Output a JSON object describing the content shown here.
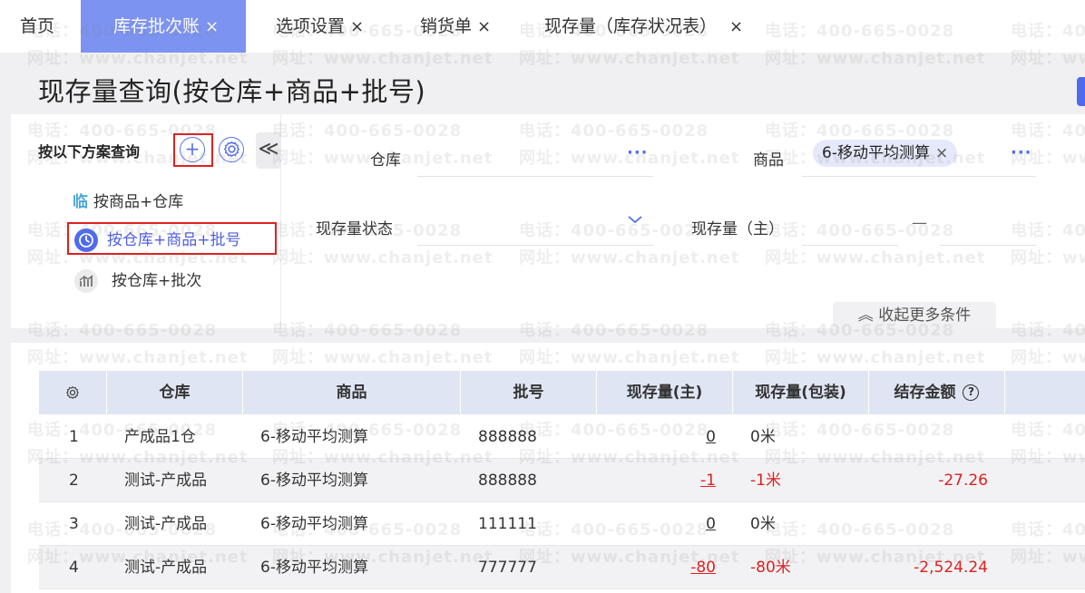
{
  "tabs": [
    {
      "label": "首页",
      "closable": false,
      "active": false
    },
    {
      "label": "库存批次账",
      "closable": true,
      "active": true
    },
    {
      "label": "选项设置",
      "closable": true,
      "active": false
    },
    {
      "label": "销货单",
      "closable": true,
      "active": false
    },
    {
      "label": "现存量（库存状况表）",
      "closable": true,
      "active": false
    }
  ],
  "close_glyph": "×",
  "page_title": "现存量查询(按仓库+商品+批号)",
  "scheme": {
    "title": "按以下方案查询",
    "add_glyph": "+",
    "collapse_glyph": "≪",
    "items": [
      {
        "label": "按商品+仓库",
        "icon": "chart-bar-icon",
        "glyph": "临"
      },
      {
        "label": "按仓库+商品+批号",
        "icon": "clock-icon",
        "active": true
      },
      {
        "label": "按仓库+批次",
        "icon": "chart-line-icon"
      }
    ]
  },
  "filters": {
    "warehouse_label": "仓库",
    "product_label": "商品",
    "product_chip": "6-移动平均测算",
    "status_label": "现存量状态",
    "qty_label": "现存量（主）",
    "qty_separator": "—",
    "dots": "···",
    "more_label": "收起更多条件",
    "more_glyph": "︽"
  },
  "table": {
    "columns": [
      "仓库",
      "商品",
      "批号",
      "现存量(主)",
      "现存量(包装)",
      "结存金额"
    ],
    "help_glyph": "?",
    "rows": [
      {
        "no": "1",
        "warehouse": "产成品1仓",
        "product": "6-移动平均测算",
        "batch": "888888",
        "qty": "0",
        "qty_pack": "0米",
        "amount": "",
        "negative": false
      },
      {
        "no": "2",
        "warehouse": "测试-产成品",
        "product": "6-移动平均测算",
        "batch": "888888",
        "qty": "-1",
        "qty_pack": "-1米",
        "amount": "-27.26",
        "negative": true
      },
      {
        "no": "3",
        "warehouse": "测试-产成品",
        "product": "6-移动平均测算",
        "batch": "111111",
        "qty": "0",
        "qty_pack": "0米",
        "amount": "",
        "negative": false
      },
      {
        "no": "4",
        "warehouse": "测试-产成品",
        "product": "6-移动平均测算",
        "batch": "777777",
        "qty": "-80",
        "qty_pack": "-80米",
        "amount": "-2,524.24",
        "negative": true
      }
    ]
  },
  "watermark": {
    "phone": "电话：400-665-0028",
    "site": "网址：www.chanjet.net"
  },
  "colors": {
    "accent": "#4f6bed",
    "active_tab": "#7d93f2",
    "highlight_box": "#e02020",
    "negative": "#e02020",
    "table_header": "#dfe5f3"
  }
}
